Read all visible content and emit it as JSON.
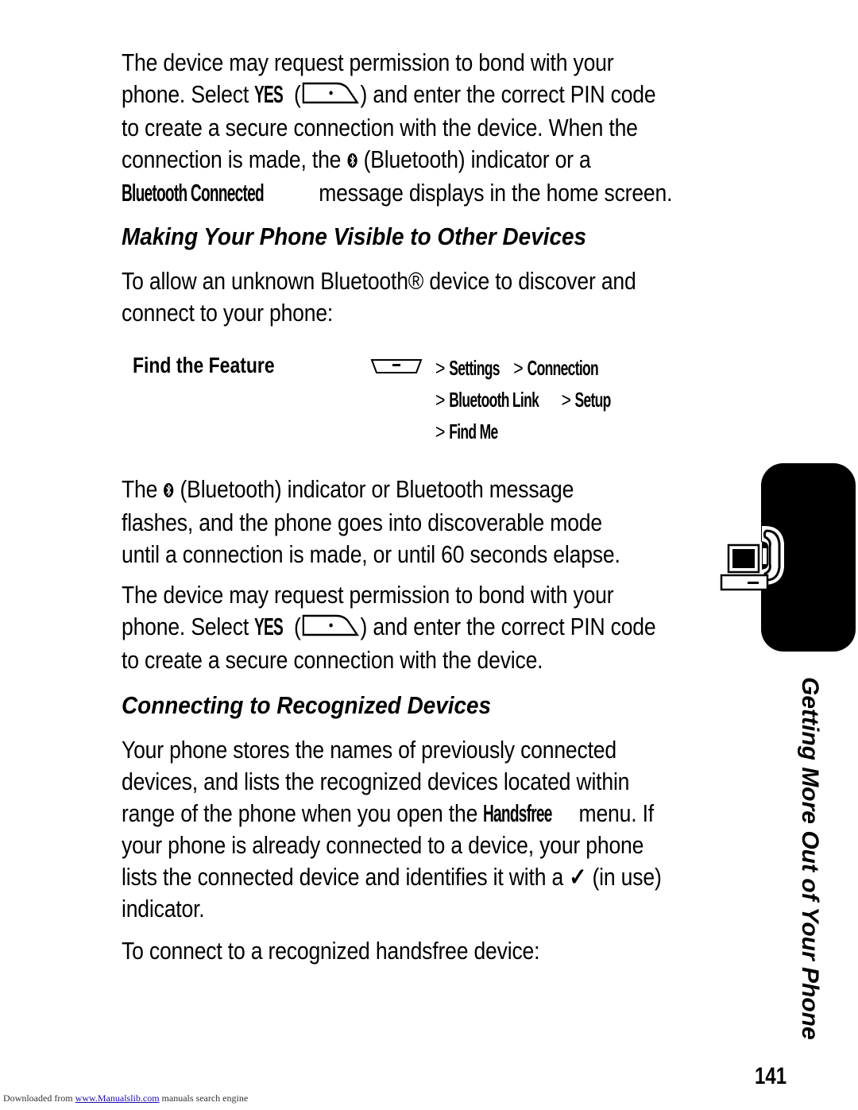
{
  "intro": {
    "lines": [
      [
        "The device may request permission to bond with your"
      ],
      [
        "phone. Select ",
        "YES",
        " (",
        "soft-key-right-icon",
        ") and enter the correct PIN code"
      ],
      [
        "to create a secure connection with the device. When the"
      ],
      [
        "connection is made, the ",
        "bluetooth-icon",
        " (Bluetooth) indicator or a"
      ],
      [
        "Bluetooth Connected",
        " message displays in the home screen."
      ]
    ],
    "l1": "The device may request permission to bond with your",
    "l2a": "phone. Select ",
    "l2_key": "YES",
    "l2b": " (",
    "l2c": ") and enter the correct PIN code",
    "l3": "to create a secure connection with the device. When the",
    "l4a": "connection is made, the ",
    "l4b": " (Bluetooth) indicator or a",
    "l5_key": "Bluetooth Connected",
    "l5b": " message displays in the home screen."
  },
  "section1": {
    "heading": "Making Your Phone Visible to Other Devices",
    "intro_l1": "To allow an unknown Bluetooth® device to discover and",
    "intro_l2": "connect to your phone:",
    "find_feature": {
      "label": "Find the Feature",
      "key_icon": "menu-key-icon",
      "path": [
        [
          "Settings",
          "Connection"
        ],
        [
          "Bluetooth Link",
          "Setup"
        ],
        [
          "Find Me"
        ]
      ],
      "separator": ">"
    },
    "p2_l1a": "The ",
    "p2_l1b": " (Bluetooth) indicator or Bluetooth message",
    "p2_l2": "flashes, and the phone goes into discoverable mode",
    "p2_l3": "until a connection is made, or until 60 seconds elapse.",
    "p3_l1": "The device may request permission to bond with your",
    "p3_l2a": "phone. Select ",
    "p3_l2_key": "YES",
    "p3_l2b": " (",
    "p3_l2c": ") and enter the correct PIN code",
    "p3_l3": "to create a secure connection with the device."
  },
  "section2": {
    "heading": "Connecting to Recognized Devices",
    "p1_l1": "Your phone stores the names of previously connected",
    "p1_l2": "devices, and lists the recognized devices located within",
    "p1_l3a": "range of the phone when you open the ",
    "p1_l3_key": "Handsfree",
    "p1_l3b": " menu. If",
    "p1_l4": "your phone is already connected to a device, your phone",
    "p1_l5a": "lists the connected device and identifies it with a ",
    "p1_l5_icon": "✓",
    "p1_l5b": " (in use)",
    "p1_l6": "indicator.",
    "p2": "To connect to a recognized handsfree device:"
  },
  "sidebar": {
    "chapter_title": "Getting More Out of Your Phone",
    "tab_icon": "computer-phone-icon"
  },
  "page_number": "141",
  "footer": {
    "prefix": "Downloaded from ",
    "link": "www.Manualslib.com",
    "suffix": " manuals search engine"
  }
}
